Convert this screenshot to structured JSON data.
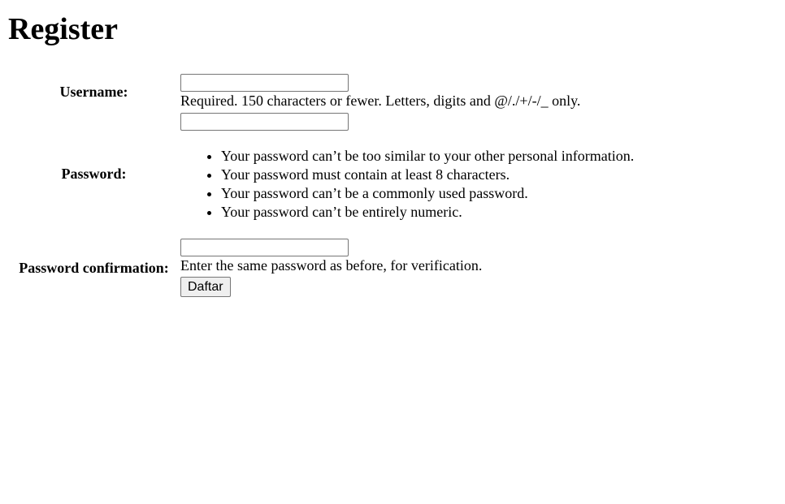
{
  "page": {
    "title": "Register"
  },
  "form": {
    "username": {
      "label": "Username:",
      "value": "",
      "help": "Required. 150 characters or fewer. Letters, digits and @/./+/-/_ only."
    },
    "password": {
      "label": "Password:",
      "value": "",
      "rules": [
        "Your password can’t be too similar to your other personal information.",
        "Your password must contain at least 8 characters.",
        "Your password can’t be a commonly used password.",
        "Your password can’t be entirely numeric."
      ]
    },
    "password_confirmation": {
      "label": "Password confirmation:",
      "value": "",
      "help": "Enter the same password as before, for verification."
    },
    "submit_label": "Daftar"
  }
}
